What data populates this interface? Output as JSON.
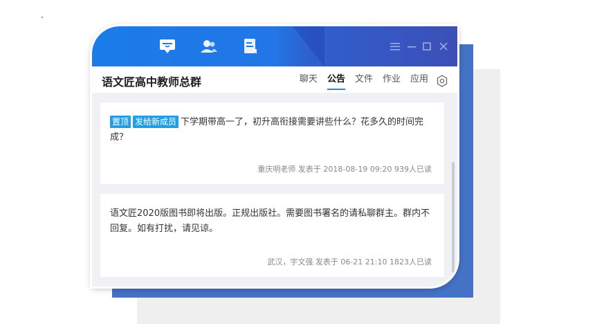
{
  "window": {
    "group_name": "语文匠高中教师总群",
    "nav_icons": [
      "chat-icon",
      "contacts-icon",
      "notes-icon"
    ],
    "controls": [
      "menu-icon",
      "minimize-icon",
      "maximize-icon",
      "close-icon"
    ]
  },
  "tabs": [
    {
      "label": "聊天",
      "active": false
    },
    {
      "label": "公告",
      "active": true
    },
    {
      "label": "文件",
      "active": false
    },
    {
      "label": "作业",
      "active": false
    },
    {
      "label": "应用",
      "active": false
    }
  ],
  "announcements": [
    {
      "tags": [
        "置顶",
        "发给新成员"
      ],
      "text": "下学期带高一了，初升高衔接需要讲些什么？花多久的时间完成？",
      "meta": "重庆明老师 发表于 2018-08-19 09:20  939人已读"
    },
    {
      "tags": [],
      "text": "语文匠2020版图书即将出版。正规出版社。需要图书署名的请私聊群主。群内不回复。如有打扰，请见谅。",
      "meta": "武汉，宇文强 发表于 06-21 21:10  1823人已读"
    }
  ],
  "colors": {
    "titlebar": "#1a7ce8",
    "accent": "#2283e6",
    "tag": "#1f9fe8",
    "backdrop_blue": "#4472c4",
    "backdrop_gray": "#efeff0"
  }
}
